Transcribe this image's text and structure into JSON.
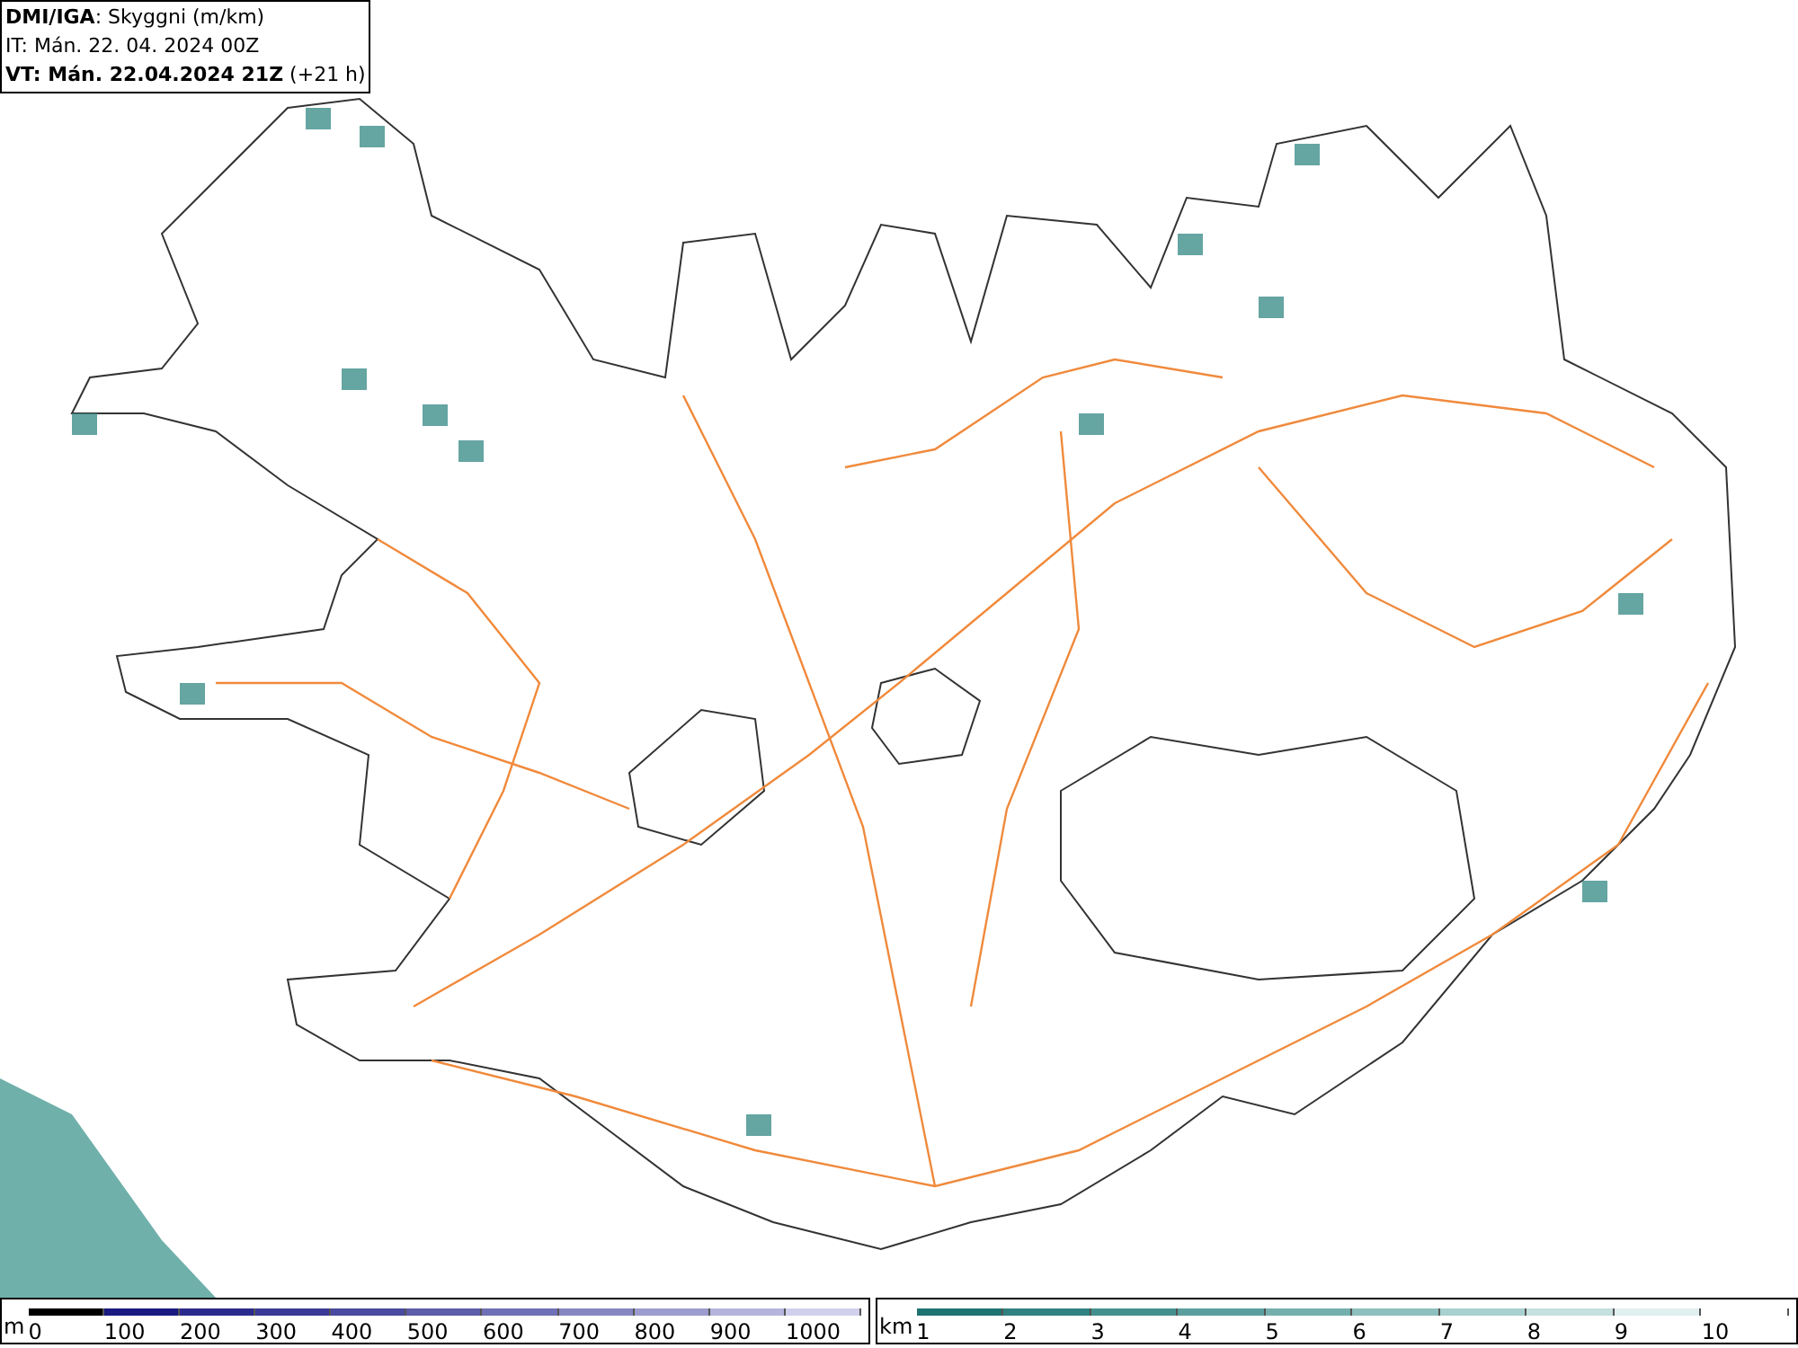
{
  "title_box": {
    "lines": [
      "**DMI/IGA**: Skyggni (m/km)",
      "IT: Mán. 22. 04. 2024 00Z",
      "**VT: Mán. 22.04.2024 21Z** (+21 h)"
    ]
  },
  "legends": [
    {
      "unit": "m",
      "steps": [
        {
          "label": "0",
          "color": "#000000"
        },
        {
          "label": "100",
          "color": "#1a1a80"
        },
        {
          "label": "200",
          "color": "#2a2a8c"
        },
        {
          "label": "300",
          "color": "#3a3a96"
        },
        {
          "label": "400",
          "color": "#4a4aa0"
        },
        {
          "label": "500",
          "color": "#5c5caa"
        },
        {
          "label": "600",
          "color": "#7070b6"
        },
        {
          "label": "700",
          "color": "#8686c2"
        },
        {
          "label": "800",
          "color": "#9c9cce"
        },
        {
          "label": "900",
          "color": "#b4b4dc"
        },
        {
          "label": "1000",
          "color": "#d0d0ec"
        }
      ]
    },
    {
      "unit": "km",
      "steps": [
        {
          "label": "1",
          "color": "#1e7370"
        },
        {
          "label": "2",
          "color": "#2f827f"
        },
        {
          "label": "3",
          "color": "#43918e"
        },
        {
          "label": "4",
          "color": "#5a9f9d"
        },
        {
          "label": "5",
          "color": "#72afad"
        },
        {
          "label": "6",
          "color": "#8cbfbd"
        },
        {
          "label": "7",
          "color": "#a8d0ce"
        },
        {
          "label": "8",
          "color": "#c4e0df"
        },
        {
          "label": "9",
          "color": "#e0efef"
        },
        {
          "label": "10",
          "color": "#ffffff"
        }
      ]
    }
  ]
}
